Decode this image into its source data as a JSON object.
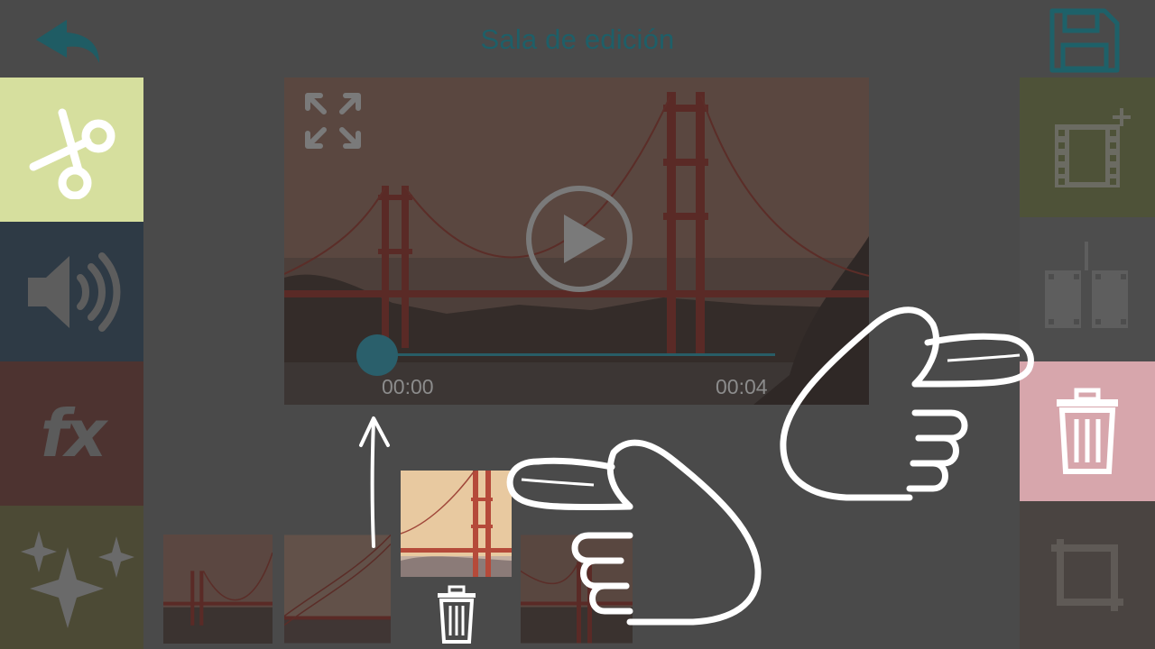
{
  "header": {
    "title": "Sala de edición",
    "back_icon": "back-arrow-icon",
    "save_icon": "floppy-disk-icon"
  },
  "left_toolbar": {
    "items": [
      {
        "id": "cut",
        "icon": "scissors-icon",
        "color": "#d6df9e",
        "selected": true
      },
      {
        "id": "audio",
        "icon": "speaker-icon",
        "color": "#2e3a45"
      },
      {
        "id": "effects",
        "label": "fx",
        "icon": "fx-icon",
        "color": "#4d3330"
      },
      {
        "id": "sparkles",
        "icon": "sparkles-icon",
        "color": "#4c4a35"
      }
    ]
  },
  "right_toolbar": {
    "items": [
      {
        "id": "add-clip",
        "icon": "film-add-icon",
        "color": "#4e5238"
      },
      {
        "id": "split-clip",
        "icon": "film-split-icon",
        "color": "#4d4d4d"
      },
      {
        "id": "delete-clip",
        "icon": "trash-icon",
        "color": "#d7a6ac",
        "highlighted": true
      },
      {
        "id": "crop",
        "icon": "crop-icon",
        "color": "#4a4441"
      }
    ]
  },
  "player": {
    "current_time": "00:00",
    "duration": "00:04",
    "progress": 0,
    "play_icon": "play-icon",
    "fullscreen_icon": "fullscreen-icon"
  },
  "timeline": {
    "clips": [
      {
        "icon": "bridge-thumbnail"
      },
      {
        "icon": "bridge-thumbnail"
      },
      {
        "icon": "bridge-thumbnail",
        "selected": true,
        "action_icon": "trash-icon"
      },
      {
        "icon": "bridge-thumbnail"
      }
    ]
  },
  "tutorial_overlay": {
    "gestures": [
      "hand-pointer-icon",
      "hand-pointer-icon"
    ],
    "arrow_icon": "arrow-up-icon"
  }
}
